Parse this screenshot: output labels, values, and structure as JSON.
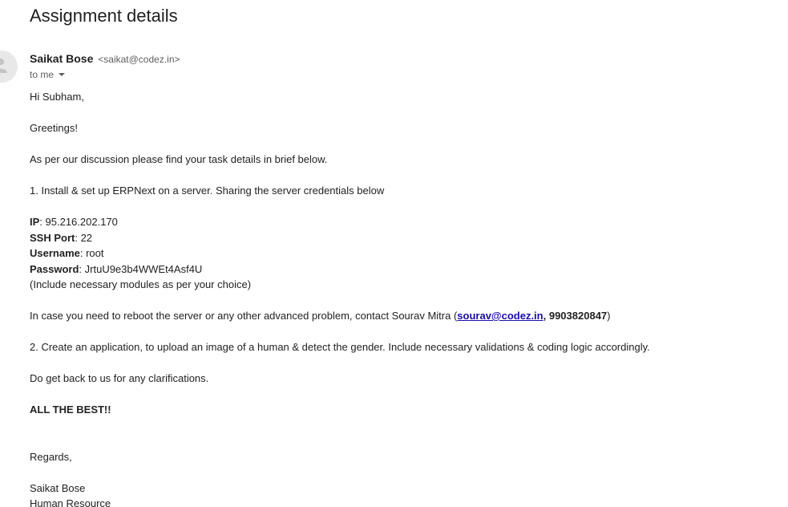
{
  "email": {
    "subject": "Assignment details",
    "sender": {
      "name": "Saikat Bose",
      "email": "<saikat@codez.in>",
      "avatar_icon": "person-icon"
    },
    "recipient": {
      "label": "to me"
    },
    "body": {
      "greeting": "Hi Subham,",
      "greetings": "Greetings!",
      "intro": "As per our discussion please find your task details in brief below.",
      "task1": "1. Install & set up ERPNext on a server. Sharing the server credentials below",
      "credentials": [
        {
          "label": "IP",
          "value": ": 95.216.202.170"
        },
        {
          "label": "SSH Port",
          "value": ": 22"
        },
        {
          "label": "Username",
          "value": ": root"
        },
        {
          "label": "Password",
          "value": ": JrtuU9e3b4WWEt4Asf4U"
        }
      ],
      "modules_note": "(Include necessary modules as per your choice)",
      "contact_prefix": "In case you need to reboot the server or any other advanced problem, contact Sourav Mitra (",
      "contact_email": "sourav@codez.in",
      "contact_phone": ", 9903820847",
      "contact_suffix": ")",
      "task2": "2. Create an application, to upload an image of a human & detect the gender. Include necessary validations & coding logic accordingly.",
      "clarifications": "Do get back to us for any clarifications.",
      "all_the_best": "ALL THE BEST!!",
      "regards": "Regards,",
      "signature_name": "Saikat Bose",
      "signature_title": "Human Resource"
    },
    "colors": {
      "link": "#1a0dab",
      "meta_text": "#5e5e5e"
    }
  }
}
